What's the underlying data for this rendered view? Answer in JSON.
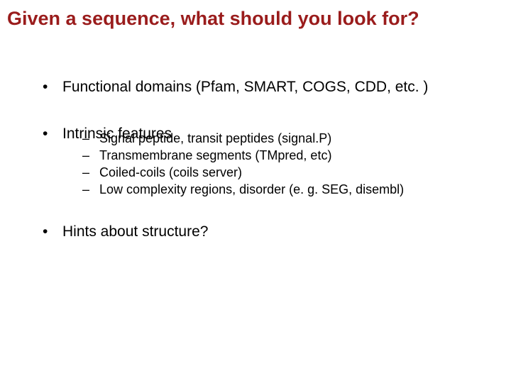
{
  "title": "Given a sequence, what should you look for?",
  "bullets": [
    {
      "text": "Functional domains (Pfam, SMART, COGS, CDD, etc. )"
    },
    {
      "text": "Intrinsic features"
    },
    {
      "text": "Hints about structure?"
    }
  ],
  "sub": [
    {
      "text": "Signal peptide, transit peptides (signal.P)"
    },
    {
      "text": "Transmembrane segments (TMpred, etc)"
    },
    {
      "text": "Coiled-coils (coils server)"
    },
    {
      "text": "Low complexity regions, disorder (e. g. SEG, disembl)"
    }
  ],
  "markers": {
    "dot": "•",
    "dash": "–"
  }
}
